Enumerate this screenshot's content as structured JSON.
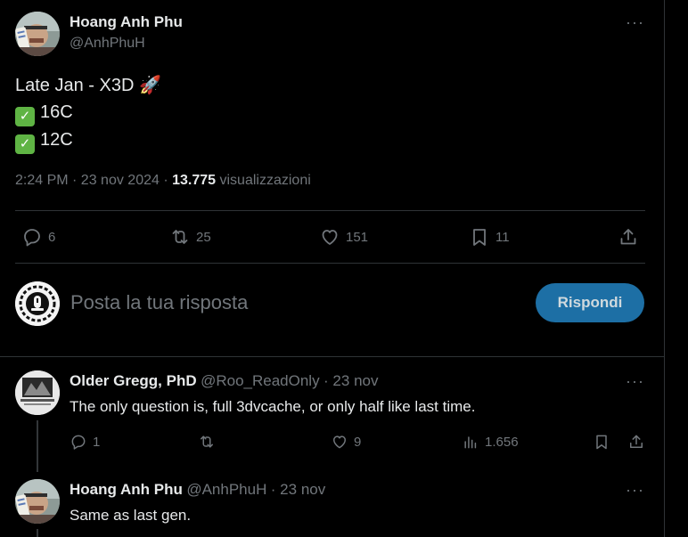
{
  "main_tweet": {
    "author_name": "Hoang Anh Phu",
    "author_handle": "@AnhPhuH",
    "line1": "Late Jan - X3D",
    "line1_emoji": "🚀",
    "items": [
      "16C",
      "12C"
    ],
    "time": "2:24 PM · 23 nov 2024 ·",
    "views_count": "13.775",
    "views_label": "visualizzazioni",
    "stats": {
      "replies": "6",
      "reposts": "25",
      "likes": "151",
      "bookmarks": "11"
    }
  },
  "composer": {
    "placeholder": "Posta la tua risposta",
    "button_label": "Rispondi"
  },
  "replies": [
    {
      "author_name": "Older Gregg, PhD",
      "author_handle": "@Roo_ReadOnly",
      "date": "· 23 nov",
      "text": "The only question is, full 3dvcache, or only half like last time.",
      "stats": {
        "replies": "1",
        "reposts": "",
        "likes": "9",
        "views": "1.656"
      }
    },
    {
      "author_name": "Hoang Anh Phu",
      "author_handle": "@AnhPhuH",
      "date": "· 23 nov",
      "text": "Same as last gen."
    }
  ],
  "more_label": "···",
  "icons": [
    "reply-icon",
    "repost-icon",
    "like-icon",
    "bookmark-icon",
    "share-icon",
    "views-icon",
    "more-icon",
    "check-icon",
    "rocket-emoji"
  ],
  "colors": {
    "background": "#000000",
    "text": "#e7e9ea",
    "muted": "#71767b",
    "accent_button": "#1d6fa5",
    "check": "#5fb444",
    "divider": "#2f3336"
  }
}
